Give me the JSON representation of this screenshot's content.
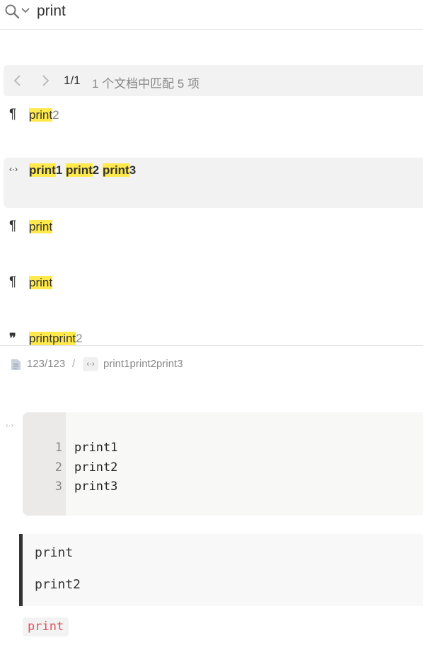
{
  "search": {
    "query": "print",
    "placeholder": ""
  },
  "navigation": {
    "page_count": "1/1",
    "match_summary": "1 个文档中匹配 5 项"
  },
  "results": [
    {
      "icon": "¶",
      "icon_name": "paragraph-icon",
      "prefix": "",
      "match1": "print",
      "rest1": "2",
      "selected": false
    },
    {
      "icon": "‹·›",
      "icon_name": "code-block-icon",
      "m1": "print",
      "t1": "1 ",
      "m2": "print",
      "t2": "2 ",
      "m3": "print",
      "t3": "3",
      "selected": true
    },
    {
      "icon": "¶",
      "icon_name": "paragraph-icon",
      "match1": "print",
      "rest1": ""
    },
    {
      "icon": "¶",
      "icon_name": "paragraph-icon",
      "match1": "print",
      "rest1": ""
    },
    {
      "icon": "❞",
      "icon_name": "blockquote-icon",
      "match1": "print",
      "match2": "print",
      "rest1": "2"
    }
  ],
  "breadcrumb": {
    "doc_path": "123/123",
    "separator": "/",
    "block_icon": "‹·›",
    "block_label": "print1print2print3"
  },
  "preview": {
    "code_lines": [
      {
        "num": "1",
        "code": "print1"
      },
      {
        "num": "2",
        "code": "print2"
      },
      {
        "num": "3",
        "code": "print3"
      }
    ],
    "quote_lines": [
      "print",
      "print2"
    ],
    "inline_code": "print"
  },
  "colors": {
    "highlight": "#ffe94d",
    "inline_code_text": "#e0505f",
    "selected_bg": "#f2f2f2"
  }
}
